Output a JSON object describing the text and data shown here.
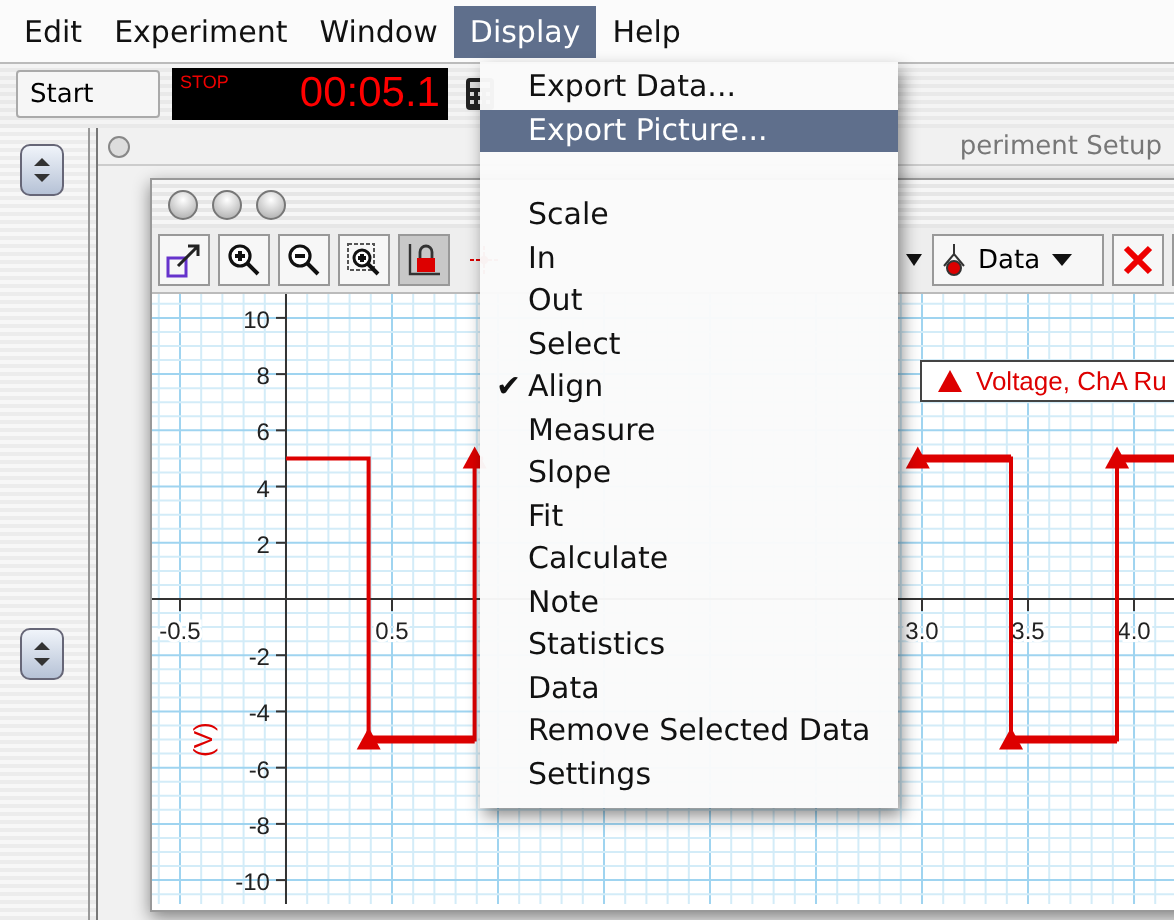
{
  "menubar": [
    {
      "label": "Edit",
      "selected": false
    },
    {
      "label": "Experiment",
      "selected": false
    },
    {
      "label": "Window",
      "selected": false
    },
    {
      "label": "Display",
      "selected": true
    },
    {
      "label": "Help",
      "selected": false
    }
  ],
  "toolbar": {
    "start_button": "Start",
    "timer_status": "STOP",
    "timer": "00:05.1"
  },
  "back_window": {
    "title": "periment Setup"
  },
  "graph_window": {
    "data_menu": "Data",
    "y_unit": "(V)",
    "chart_data": {
      "type": "line",
      "grid": true,
      "x": [
        0,
        0.39,
        0.39,
        0.89,
        0.89,
        0.93,
        null,
        null,
        null,
        null,
        null,
        null,
        2.98,
        3.42,
        3.42,
        3.92,
        3.92,
        4.19
      ],
      "xlim": [
        -0.632,
        4.198
      ],
      "ylim": [
        -10.85,
        10.85
      ],
      "xticks": [
        {
          "value": -0.5,
          "label": "-0.5"
        },
        {
          "value": 0.5,
          "label": "0.5"
        },
        {
          "value": 3,
          "label": "3.0"
        },
        {
          "value": 3.5,
          "label": "3.5"
        },
        {
          "value": 4,
          "label": "4.0"
        }
      ],
      "yticks": [
        -10,
        -8,
        -6,
        -4,
        -2,
        2,
        4,
        6,
        8,
        10
      ],
      "series": [
        {
          "name": "Voltage, ChA Ru",
          "color": "#dd0000",
          "values": [
            5,
            5,
            -5,
            -5,
            5,
            5,
            null,
            null,
            null,
            null,
            null,
            null,
            5,
            5,
            -5,
            -5,
            5,
            5
          ]
        }
      ]
    }
  },
  "menu": {
    "check_mark": "✔",
    "items": [
      {
        "kind": "item",
        "label": "Export Data...",
        "selected": false,
        "checked": false
      },
      {
        "kind": "item",
        "label": "Export Picture...",
        "selected": true,
        "checked": false
      },
      {
        "kind": "separator"
      },
      {
        "kind": "item",
        "label": "Scale",
        "selected": false,
        "checked": false
      },
      {
        "kind": "item",
        "label": "In",
        "selected": false,
        "checked": false
      },
      {
        "kind": "item",
        "label": "Out",
        "selected": false,
        "checked": false
      },
      {
        "kind": "item",
        "label": "Select",
        "selected": false,
        "checked": false
      },
      {
        "kind": "item",
        "label": "Align",
        "selected": false,
        "checked": true
      },
      {
        "kind": "item",
        "label": "Measure",
        "selected": false,
        "checked": false
      },
      {
        "kind": "item",
        "label": "Slope",
        "selected": false,
        "checked": false
      },
      {
        "kind": "item",
        "label": "Fit",
        "selected": false,
        "checked": false
      },
      {
        "kind": "item",
        "label": "Calculate",
        "selected": false,
        "checked": false
      },
      {
        "kind": "item",
        "label": "Note",
        "selected": false,
        "checked": false
      },
      {
        "kind": "item",
        "label": "Statistics",
        "selected": false,
        "checked": false
      },
      {
        "kind": "item",
        "label": "Data",
        "selected": false,
        "checked": false
      },
      {
        "kind": "item",
        "label": "Remove Selected Data",
        "selected": false,
        "checked": false
      },
      {
        "kind": "item",
        "label": "Settings",
        "selected": false,
        "checked": false
      }
    ]
  }
}
